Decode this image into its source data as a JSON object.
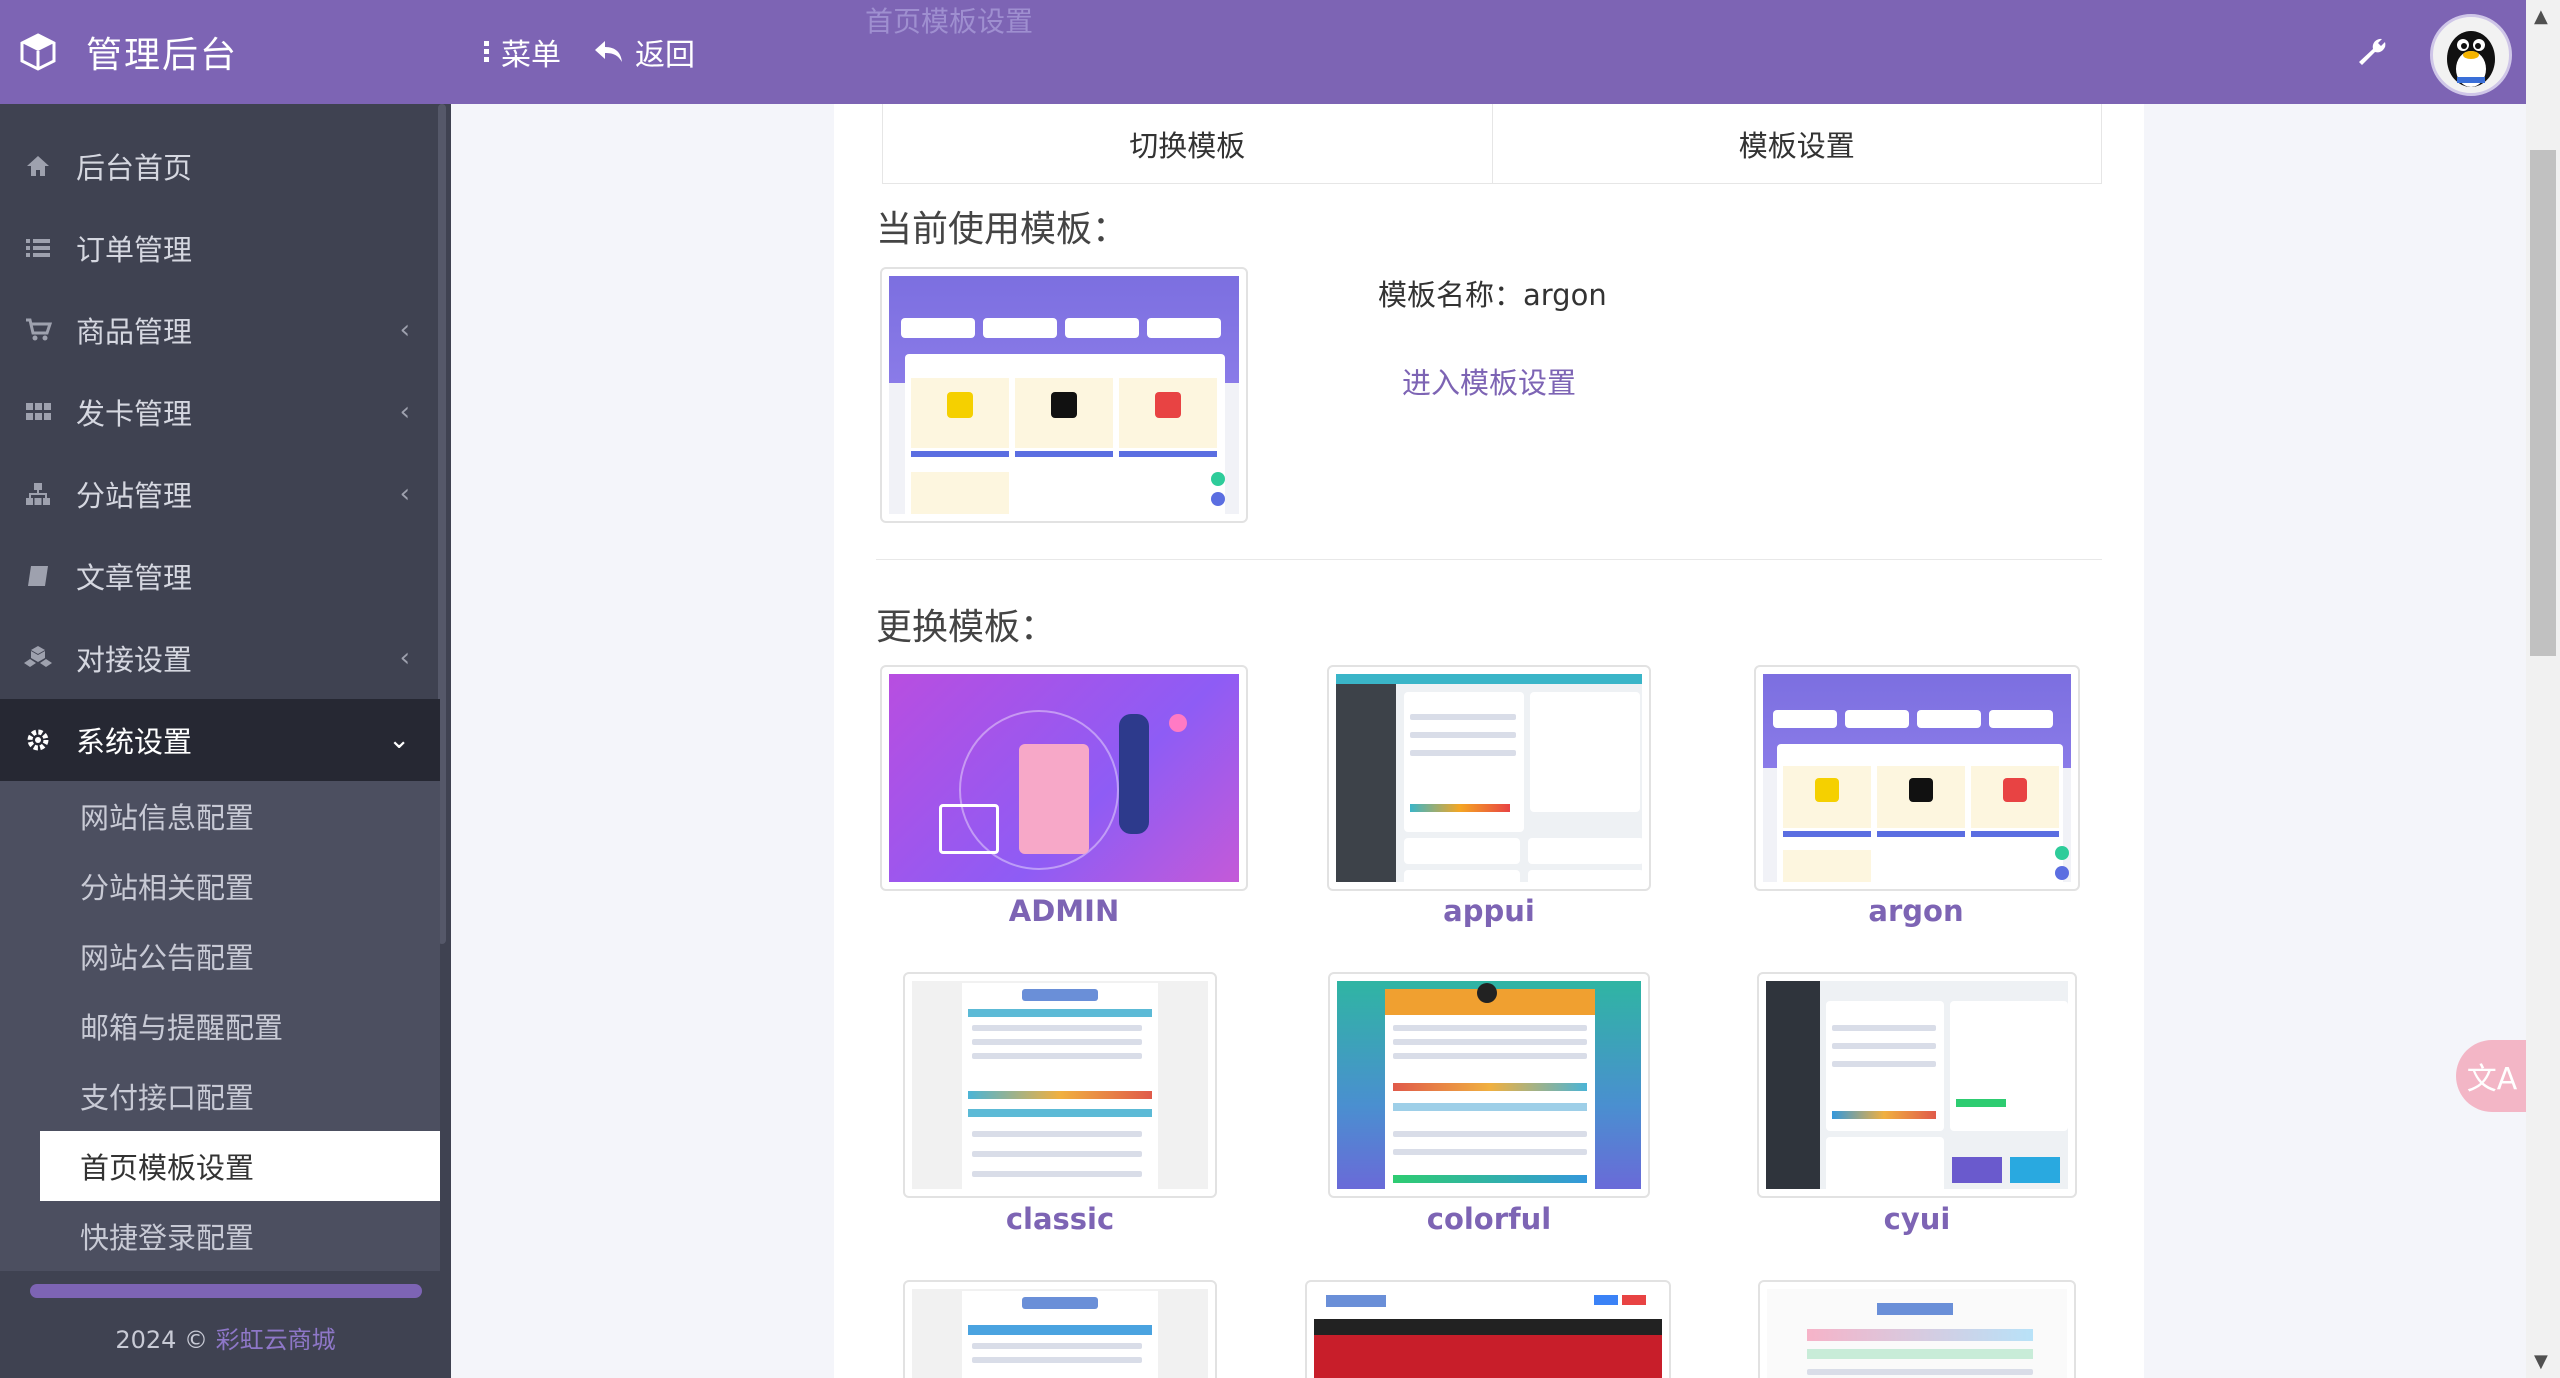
{
  "app": {
    "title": "管理后台",
    "footer_year": "2024 ©",
    "footer_link": "彩虹云商城"
  },
  "topbar": {
    "menu_label": "菜单",
    "back_label": "返回",
    "ghost_title": "首页模板设置"
  },
  "sidebar": {
    "items": [
      {
        "label": "后台首页",
        "icon": "home-icon",
        "has_children": false
      },
      {
        "label": "订单管理",
        "icon": "list-icon",
        "has_children": false
      },
      {
        "label": "商品管理",
        "icon": "cart-icon",
        "has_children": true
      },
      {
        "label": "发卡管理",
        "icon": "grid-icon",
        "has_children": true
      },
      {
        "label": "分站管理",
        "icon": "sitemap-icon",
        "has_children": true
      },
      {
        "label": "文章管理",
        "icon": "book-icon",
        "has_children": false
      },
      {
        "label": "对接设置",
        "icon": "cubes-icon",
        "has_children": true
      },
      {
        "label": "系统设置",
        "icon": "gear-icon",
        "has_children": true,
        "active": true
      }
    ],
    "sub_items": [
      {
        "label": "网站信息配置"
      },
      {
        "label": "分站相关配置"
      },
      {
        "label": "网站公告配置"
      },
      {
        "label": "邮箱与提醒配置"
      },
      {
        "label": "支付接口配置"
      },
      {
        "label": "首页模板设置",
        "current": true
      },
      {
        "label": "快捷登录配置"
      }
    ]
  },
  "main": {
    "tabs": [
      {
        "label": "切换模板"
      },
      {
        "label": "模板设置"
      }
    ],
    "current_section_title": "当前使用模板：",
    "template_name_label": "模板名称：argon",
    "enter_settings_link": "进入模板设置",
    "change_section_title": "更换模板：",
    "templates": [
      {
        "name": "ADMIN"
      },
      {
        "name": "appui"
      },
      {
        "name": "argon"
      },
      {
        "name": "classic"
      },
      {
        "name": "colorful"
      },
      {
        "name": "cyui"
      }
    ]
  },
  "colors": {
    "brand": "#7d64b4",
    "sidebar_bg": "#3f4251",
    "sidebar_active": "#262833",
    "link": "#7d64b4"
  }
}
